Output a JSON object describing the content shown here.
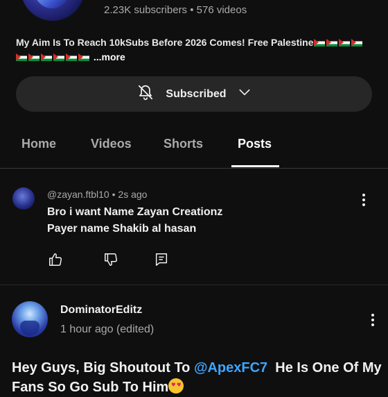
{
  "channel": {
    "stats": "2.23K subscribers • 576 videos",
    "description": "My Aim Is To Reach 10kSubs Before 2026 Comes! Free Palestine",
    "more_label": "...more",
    "subscribe_label": "Subscribed"
  },
  "tabs": [
    {
      "label": "Home"
    },
    {
      "label": "Videos"
    },
    {
      "label": "Shorts"
    },
    {
      "label": "Posts"
    }
  ],
  "comment": {
    "handle": "@zayan.ftbl10",
    "time": "2s ago",
    "line1": "Bro i want Name Zayan Creationz",
    "line2": "Payer name Shakib al hasan"
  },
  "post": {
    "author": "DominatorEditz",
    "time": "1 hour ago (edited)",
    "text_before": "Hey Guys, Big Shoutout To ",
    "mention": "@ApexFC7",
    "text_after": "  He Is One Of My Fans So Go Sub To Him"
  },
  "icons": {
    "bell": "bell-off-icon",
    "chevron": "chevron-down-icon",
    "like": "thumb-up-icon",
    "dislike": "thumb-down-icon",
    "reply": "reply-icon",
    "more": "more-vert-icon"
  },
  "colors": {
    "background": "#0f0f0f",
    "button": "#272727",
    "mention": "#3ea6ff",
    "secondary_text": "#aaaaaa"
  }
}
